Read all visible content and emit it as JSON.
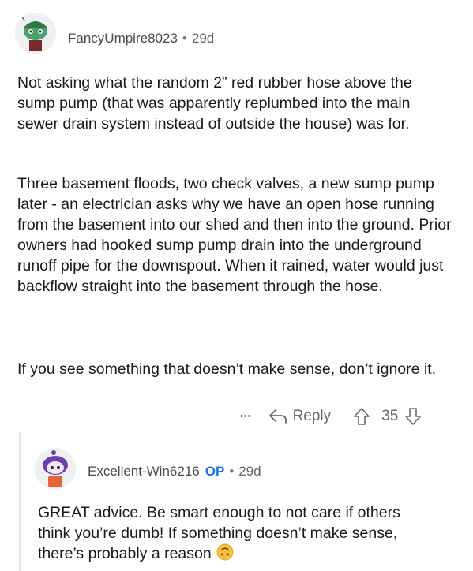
{
  "comment1": {
    "username": "FancyUmpire8023",
    "separator": "•",
    "age": "29d",
    "paragraphs": [
      "Not asking what the random 2” red rubber hose above the sump pump (that was apparently replumbed into the main sewer drain system instead of outside the house) was for.",
      "Three basement floods, two check valves, a new sump pump later - an electrician asks why we have an open hose running from the basement into our shed and then into the ground.  Prior owners had hooked sump pump drain into the underground runoff pipe for the downspout.  When it rained, water would just backflow straight into the basement through the hose.",
      "If you see something that doesn’t make sense, don’t ignore it."
    ],
    "actions": {
      "more": "•••",
      "reply_label": "Reply",
      "vote_count": "35"
    },
    "avatar_icon": "snoo-avatar-green-hat-icon"
  },
  "comment2": {
    "username": "Excellent-Win6216",
    "op_badge": "OP",
    "separator": "•",
    "age": "29d",
    "text": "GREAT advice. Be smart enough to not care if others think you’re dumb! If something doesn’t make sense, there’s probably a reason",
    "emoji": "upside-down-face-emoji",
    "avatar_icon": "snoo-avatar-purple-hair-icon"
  },
  "colors": {
    "op_blue": "#1a73e8",
    "meta_gray": "#5f6368",
    "emoji_yellow": "#f7c23b"
  }
}
